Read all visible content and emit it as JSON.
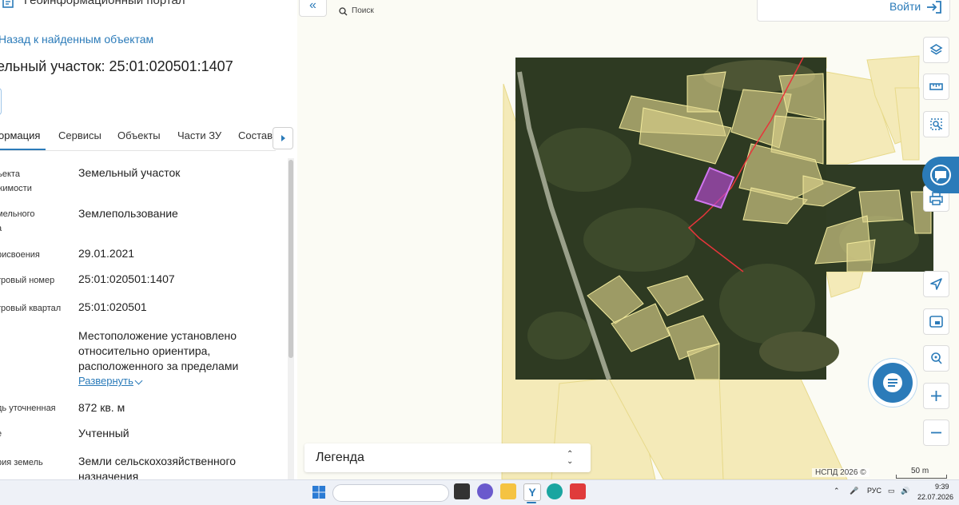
{
  "app": {
    "title": "Геоинформационный портал"
  },
  "nav": {
    "back_label": "Назад к найденным объектам"
  },
  "object": {
    "title": "ельный участок: 25:01:020501:1407"
  },
  "tabs": [
    {
      "label": "ормация"
    },
    {
      "label": "Сервисы"
    },
    {
      "label": "Объекты"
    },
    {
      "label": "Части ЗУ"
    },
    {
      "label": "Состав"
    }
  ],
  "attributes": [
    {
      "label1": "ъекта",
      "label2": "жимости",
      "value1": "Земельный участок"
    },
    {
      "label1": "мельного",
      "label2": "а",
      "value1": "Землепользование"
    },
    {
      "label1": "рисвоения",
      "value1": "29.01.2021"
    },
    {
      "label1": "тровый номер",
      "value1": "25:01:020501:1407"
    },
    {
      "label1": "тровый квартал",
      "value1": "25:01:020501"
    },
    {
      "value1": "Местоположение установлено",
      "value2": "относительно ориентира,",
      "value3": "расположенного за пределами",
      "expand_label": "Развернуть"
    },
    {
      "label1": "дь уточненная",
      "value1": "872 кв. м"
    },
    {
      "label1": "",
      "value1": "Учтенный"
    },
    {
      "label1": "рия земель",
      "value1": "Земли сельскохозяйственного",
      "value2": "назначения"
    }
  ],
  "map": {
    "login_label": "Войти",
    "legend_label": "Легенда",
    "copyright": "НСПД 2026 ©",
    "scale_label": "50 m",
    "colors": {
      "accent": "#2b7bb9",
      "parcel_fill": "#f4eab8",
      "parcel_stroke": "#e7d98a",
      "selected_parcel": "#b84ad6",
      "boundary_line": "#e8353b"
    },
    "tools": [
      "layers-icon",
      "ruler-icon",
      "select-area-icon",
      "print-icon",
      "locate-icon",
      "minimap-icon",
      "search-location-icon",
      "zoom-in-icon",
      "zoom-out-icon"
    ]
  },
  "taskbar": {
    "search_label": "Поиск",
    "lang": "РУС",
    "time": "9:39",
    "date": "22.07.2026"
  }
}
